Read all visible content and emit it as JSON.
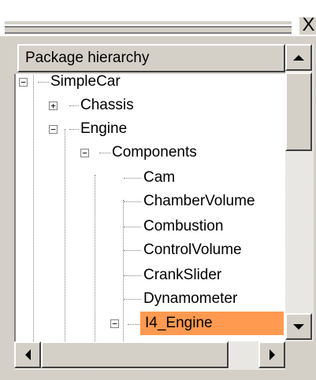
{
  "window": {
    "close_glyph": "X"
  },
  "panel": {
    "header": "Package hierarchy"
  },
  "tree": {
    "root": "SimpleCar",
    "chassis": "Chassis",
    "engine": "Engine",
    "components": "Components",
    "items": [
      "Cam",
      "ChamberVolume",
      "Combustion",
      "ControlVolume",
      "CrankSlider",
      "Dynamometer"
    ],
    "selected": "I4_Engine",
    "selected_color": "#ff9a50"
  },
  "icons": {
    "expanded": "minus-box-icon",
    "collapsed": "plus-box-icon",
    "scroll_up": "arrow-up-icon",
    "scroll_down": "arrow-down-icon",
    "scroll_left": "arrow-left-icon",
    "scroll_right": "arrow-right-icon"
  }
}
